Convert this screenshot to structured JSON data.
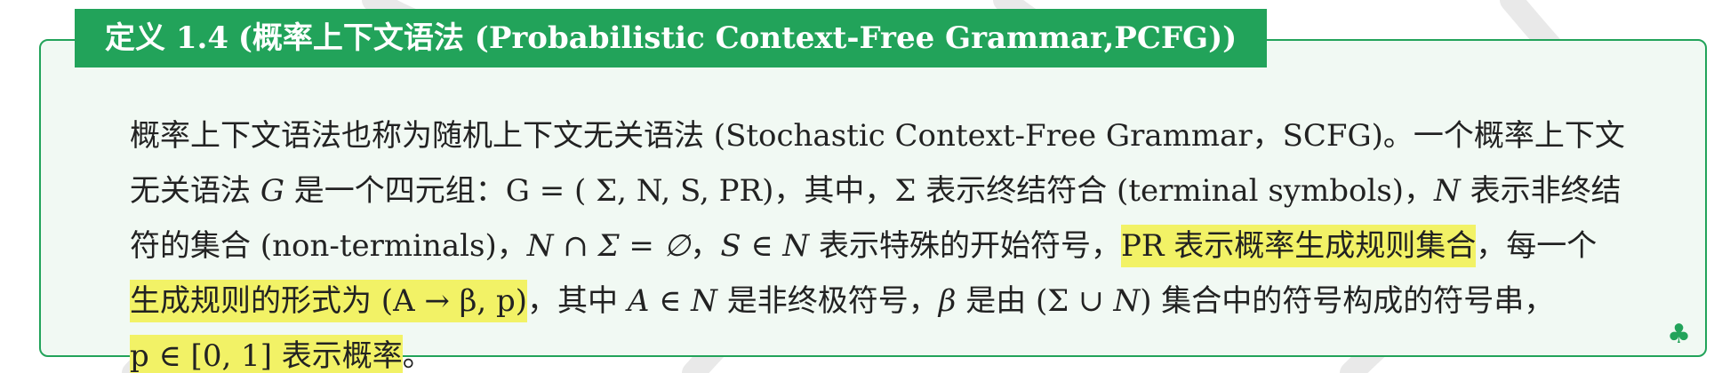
{
  "definition": {
    "header": {
      "number": "定义 1.4",
      "title": "(概率上下文语法 (Probabilistic Context-Free Grammar,PCFG))"
    },
    "lines": [
      [
        "概率上下文语法也称为随机上下文无关语法 (Stochastic Context-Free Grammar，SCFG)。一个概率上下文"
      ],
      [
        "无关语法 ",
        "G",
        " 是一个四元组：G = ( Σ, N, S, PR)，其中，Σ 表示终结符合 (terminal symbols)，",
        "N",
        " 表示非终结"
      ],
      [
        "符的集合 (non-terminals)，",
        "N ∩ Σ = ∅",
        "，",
        "S ∈ N",
        " 表示特殊的开始符号，",
        "PR 表示概率生成规则集合",
        "，每一个"
      ],
      [
        "生成规则的形式为 (A → β, p)",
        "，其中 ",
        "A ∈ N",
        " 是非终极符号，",
        "β",
        " 是由 (Σ ∪ ",
        "N",
        ") 集合中的符号构成的符号串，"
      ],
      [
        "p ∈ [0, 1] 表示概率",
        "。"
      ]
    ],
    "end_mark": "♣"
  },
  "colors": {
    "accent": "#22a35a",
    "box_background": "#f1f9f3",
    "highlight": "#f2f266",
    "text": "#222222"
  }
}
